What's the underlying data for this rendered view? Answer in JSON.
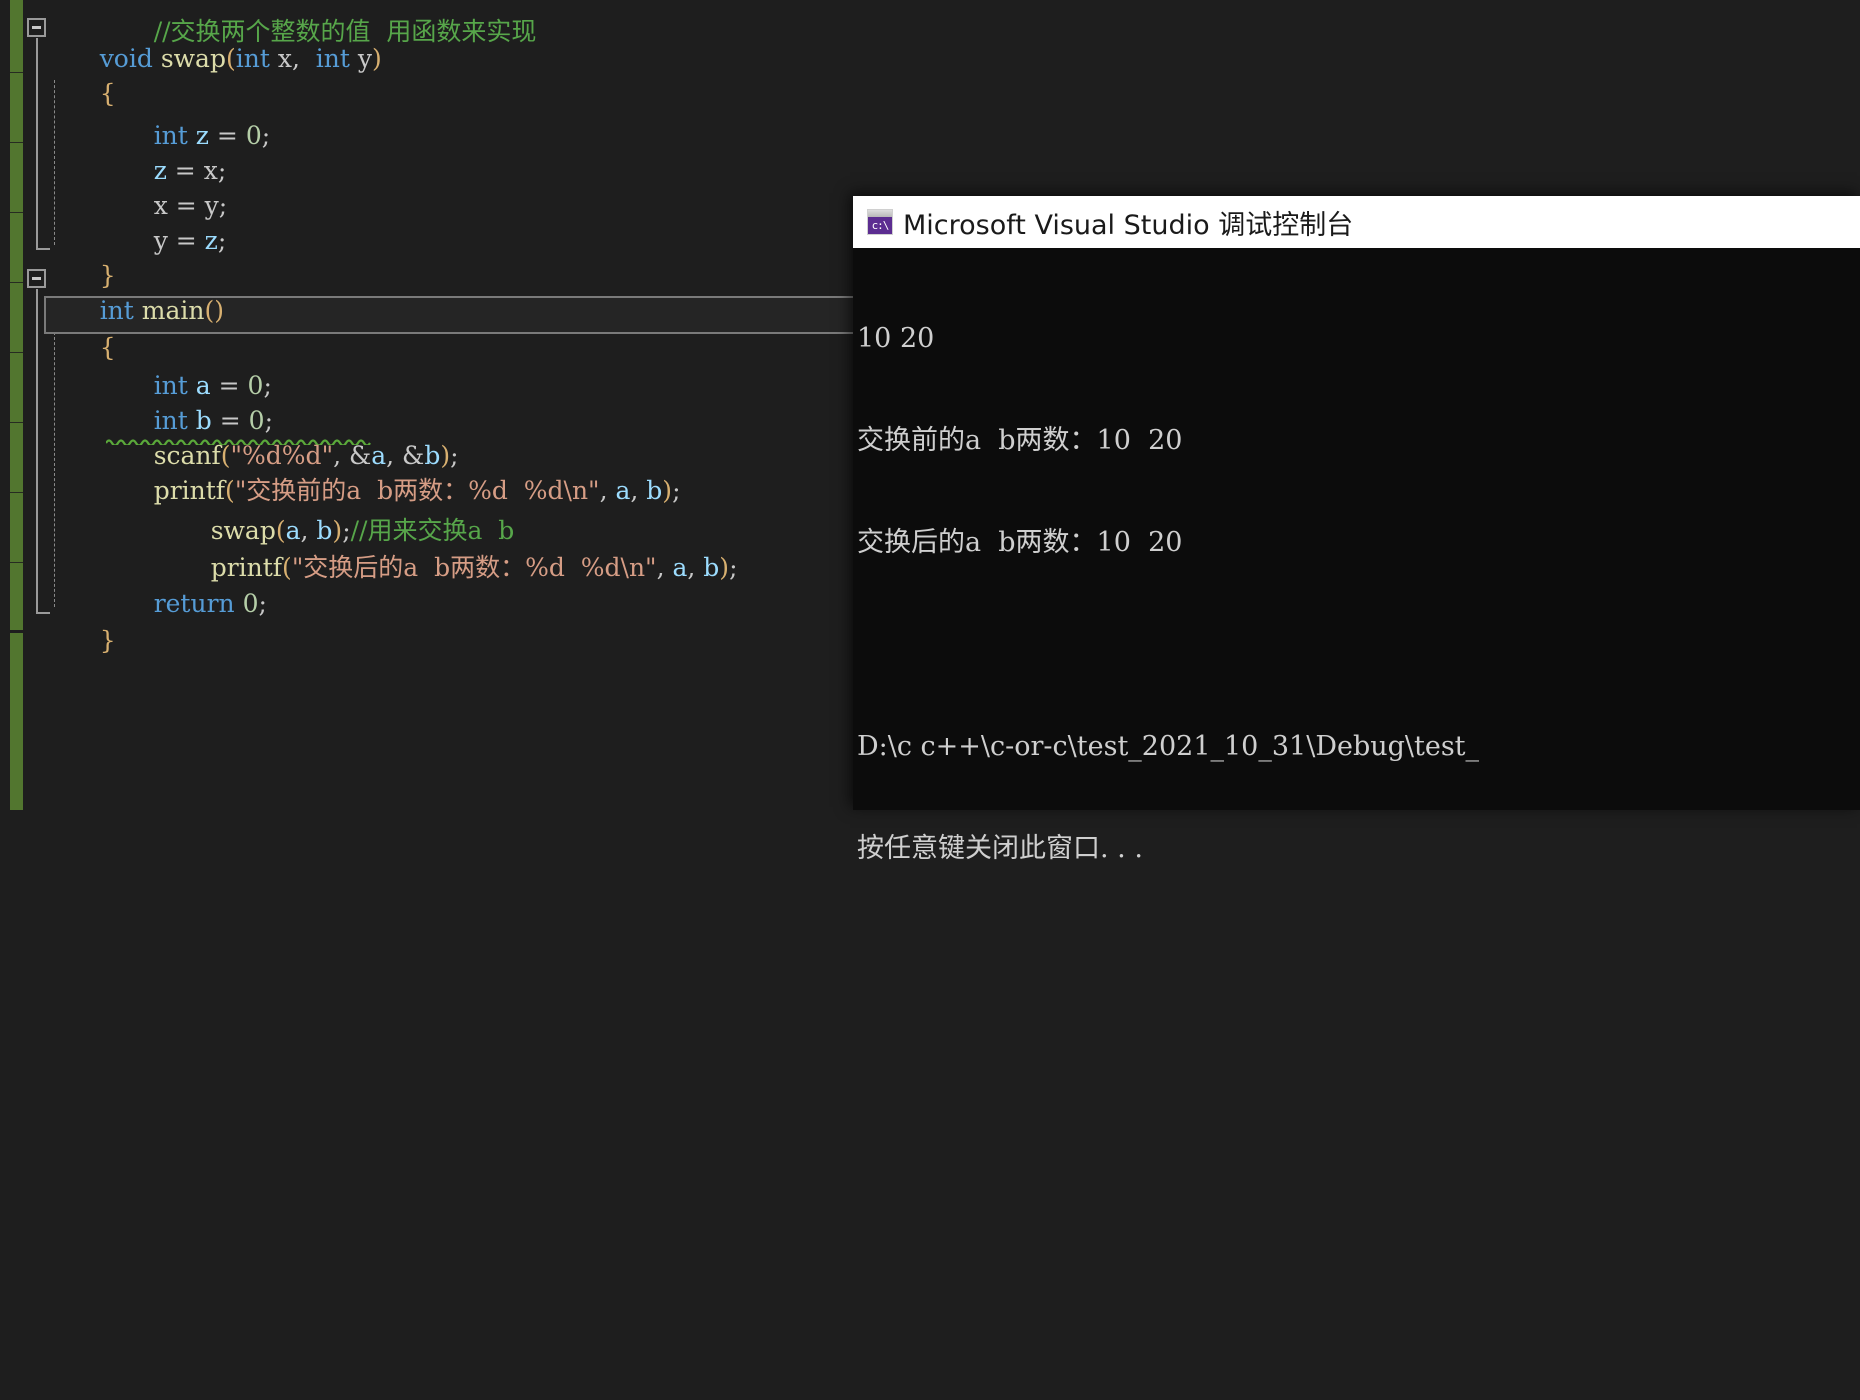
{
  "editor": {
    "theme_bg": "#1e1e1e",
    "change_bar_color": "#52762f",
    "lines": [
      {
        "indent": 0,
        "text": ""
      },
      {
        "indent": 0,
        "text": "void swap(int x, int y)"
      },
      {
        "indent": 0,
        "text": "{"
      },
      {
        "indent": 1,
        "text": "int z = 0;"
      },
      {
        "indent": 1,
        "text": "z = x;"
      },
      {
        "indent": 1,
        "text": "x = y;"
      },
      {
        "indent": 1,
        "text": "y = z;"
      },
      {
        "indent": 0,
        "text": "}"
      },
      {
        "indent": 0,
        "text": "int main()"
      },
      {
        "indent": 0,
        "text": "{"
      },
      {
        "indent": 1,
        "text": "int a = 0;"
      },
      {
        "indent": 1,
        "text": "int b = 0;"
      },
      {
        "indent": 1,
        "text": "scanf(\"%d%d\", &a, &b);"
      },
      {
        "indent": 1,
        "text": "printf(\"交换前的a  b两数：%d  %d\\n\", a, b);"
      },
      {
        "indent": 1,
        "text": "swap(a, b);//用来交换a  b"
      },
      {
        "indent": 1,
        "text": "printf(\"交换后的a  b两数：%d  %d\\n\", a, b);"
      },
      {
        "indent": 1,
        "text": "return 0;"
      },
      {
        "indent": 0,
        "text": "}"
      }
    ],
    "tokens": {
      "comment_top_partial": "//交换两个整数的值  用函数来实现",
      "kw_void": "void",
      "kw_int": "int",
      "kw_return": "return",
      "fn_swap": "swap",
      "fn_main": "main",
      "fn_scanf": "scanf",
      "fn_printf": "printf",
      "str_scanf": "\"%d%d\"",
      "str_printf_before": "\"交换前的a  b两数：%d  %d\\n\"",
      "str_printf_after": "\"交换后的a  b两数：%d  %d\\n\"",
      "comment_swap": "//用来交换a  b",
      "num_zero": "0",
      "var_x": "x",
      "var_y": "y",
      "var_z": "z",
      "var_a": "a",
      "var_b": "b"
    },
    "colors": {
      "keyword": "#569cd6",
      "function": "#dcdcaa",
      "string": "#d69d85",
      "comment": "#57a64a",
      "number": "#b5cea8",
      "variable": "#9cdcfe",
      "punctuation": "#c8c8c8",
      "bracket": "#d8b070",
      "squiggle": "#5aa83a"
    },
    "collapse_glyph": "minus-box",
    "error_squiggle_target": "scanf(\"%d%d\", &a, &b);"
  },
  "console": {
    "title": "Microsoft Visual Studio 调试控制台",
    "icon_label": "c:\\",
    "bg": "#0c0c0c",
    "titlebar_bg": "#ffffff",
    "icon_bg": "#5c2d91",
    "output_lines": [
      "10 20",
      "交换前的a  b两数：10  20",
      "交换后的a  b两数：10  20",
      "",
      "D:\\c c++\\c-or-c\\test_2021_10_31\\Debug\\test_",
      "按任意键关闭此窗口. . ."
    ]
  }
}
